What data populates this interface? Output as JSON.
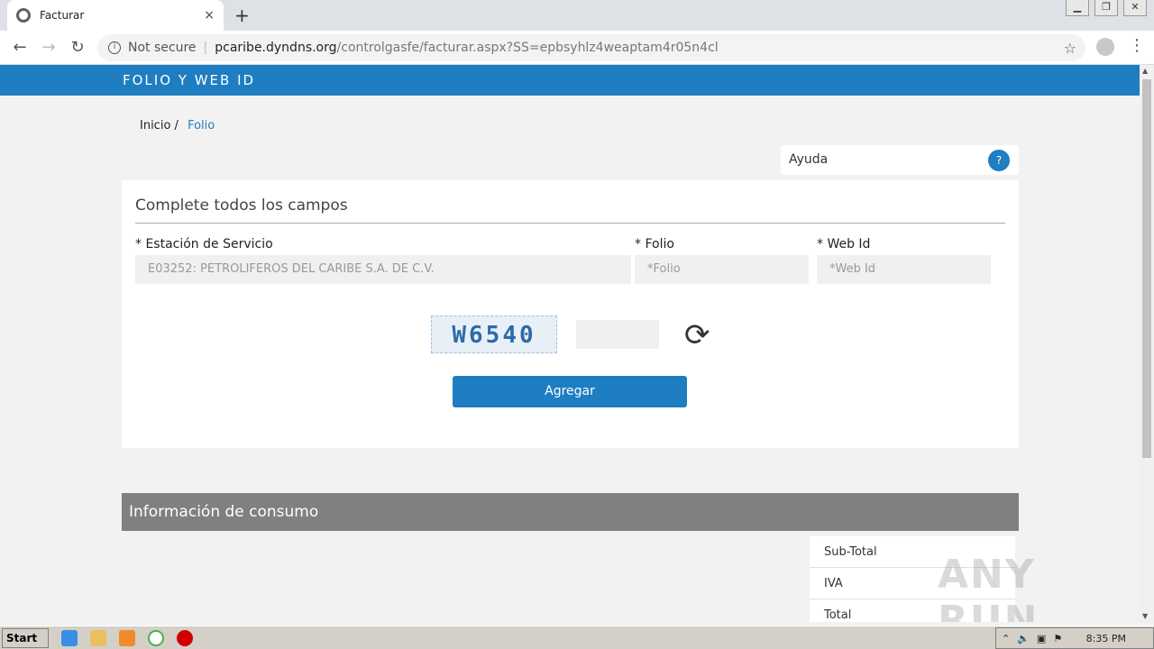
{
  "browser": {
    "tab_title": "Facturar",
    "new_tab": "+",
    "close_tab": "×",
    "security_label": "Not secure",
    "url_host": "pcaribe.dyndns.org",
    "url_path": "/controlgasfe/facturar.aspx?SS=epbsyhlz4weaptam4r05n4cl"
  },
  "page": {
    "header_title": "FOLIO Y WEB ID",
    "breadcrumb": {
      "home": "Inicio /",
      "current": "Folio"
    },
    "help": {
      "label": "Ayuda",
      "button": "?"
    },
    "form": {
      "heading": "Complete todos los campos",
      "station_label": "* Estación de Servicio",
      "station_value": "E03252: PETROLIFEROS DEL CARIBE S.A. DE C.V.",
      "folio_label": "* Folio",
      "folio_placeholder": "*Folio",
      "webid_label": "* Web Id",
      "webid_placeholder": "*Web Id",
      "captcha_text": "W6540",
      "submit_label": "Agregar"
    },
    "consumption": {
      "heading": "Información de consumo",
      "rows": [
        "Sub-Total",
        "IVA",
        "Total"
      ]
    }
  },
  "watermark": "ANY RUN",
  "taskbar": {
    "start_label": "Start",
    "clock": "8:35 PM"
  },
  "colors": {
    "accent": "#1f7dc1",
    "section_bar": "#808080"
  }
}
